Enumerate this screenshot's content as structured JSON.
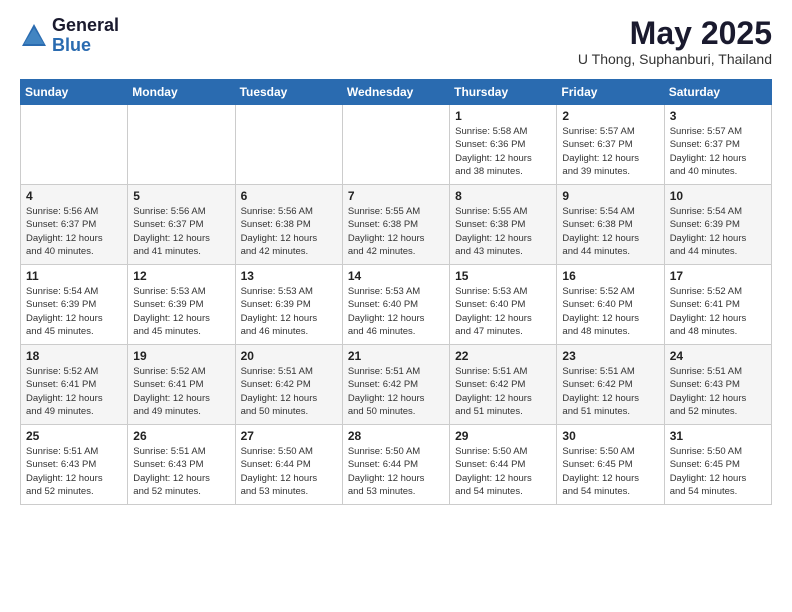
{
  "logo": {
    "general": "General",
    "blue": "Blue"
  },
  "title": "May 2025",
  "location": "U Thong, Suphanburi, Thailand",
  "weekdays": [
    "Sunday",
    "Monday",
    "Tuesday",
    "Wednesday",
    "Thursday",
    "Friday",
    "Saturday"
  ],
  "weeks": [
    [
      {
        "day": "",
        "info": ""
      },
      {
        "day": "",
        "info": ""
      },
      {
        "day": "",
        "info": ""
      },
      {
        "day": "",
        "info": ""
      },
      {
        "day": "1",
        "info": "Sunrise: 5:58 AM\nSunset: 6:36 PM\nDaylight: 12 hours\nand 38 minutes."
      },
      {
        "day": "2",
        "info": "Sunrise: 5:57 AM\nSunset: 6:37 PM\nDaylight: 12 hours\nand 39 minutes."
      },
      {
        "day": "3",
        "info": "Sunrise: 5:57 AM\nSunset: 6:37 PM\nDaylight: 12 hours\nand 40 minutes."
      }
    ],
    [
      {
        "day": "4",
        "info": "Sunrise: 5:56 AM\nSunset: 6:37 PM\nDaylight: 12 hours\nand 40 minutes."
      },
      {
        "day": "5",
        "info": "Sunrise: 5:56 AM\nSunset: 6:37 PM\nDaylight: 12 hours\nand 41 minutes."
      },
      {
        "day": "6",
        "info": "Sunrise: 5:56 AM\nSunset: 6:38 PM\nDaylight: 12 hours\nand 42 minutes."
      },
      {
        "day": "7",
        "info": "Sunrise: 5:55 AM\nSunset: 6:38 PM\nDaylight: 12 hours\nand 42 minutes."
      },
      {
        "day": "8",
        "info": "Sunrise: 5:55 AM\nSunset: 6:38 PM\nDaylight: 12 hours\nand 43 minutes."
      },
      {
        "day": "9",
        "info": "Sunrise: 5:54 AM\nSunset: 6:38 PM\nDaylight: 12 hours\nand 44 minutes."
      },
      {
        "day": "10",
        "info": "Sunrise: 5:54 AM\nSunset: 6:39 PM\nDaylight: 12 hours\nand 44 minutes."
      }
    ],
    [
      {
        "day": "11",
        "info": "Sunrise: 5:54 AM\nSunset: 6:39 PM\nDaylight: 12 hours\nand 45 minutes."
      },
      {
        "day": "12",
        "info": "Sunrise: 5:53 AM\nSunset: 6:39 PM\nDaylight: 12 hours\nand 45 minutes."
      },
      {
        "day": "13",
        "info": "Sunrise: 5:53 AM\nSunset: 6:39 PM\nDaylight: 12 hours\nand 46 minutes."
      },
      {
        "day": "14",
        "info": "Sunrise: 5:53 AM\nSunset: 6:40 PM\nDaylight: 12 hours\nand 46 minutes."
      },
      {
        "day": "15",
        "info": "Sunrise: 5:53 AM\nSunset: 6:40 PM\nDaylight: 12 hours\nand 47 minutes."
      },
      {
        "day": "16",
        "info": "Sunrise: 5:52 AM\nSunset: 6:40 PM\nDaylight: 12 hours\nand 48 minutes."
      },
      {
        "day": "17",
        "info": "Sunrise: 5:52 AM\nSunset: 6:41 PM\nDaylight: 12 hours\nand 48 minutes."
      }
    ],
    [
      {
        "day": "18",
        "info": "Sunrise: 5:52 AM\nSunset: 6:41 PM\nDaylight: 12 hours\nand 49 minutes."
      },
      {
        "day": "19",
        "info": "Sunrise: 5:52 AM\nSunset: 6:41 PM\nDaylight: 12 hours\nand 49 minutes."
      },
      {
        "day": "20",
        "info": "Sunrise: 5:51 AM\nSunset: 6:42 PM\nDaylight: 12 hours\nand 50 minutes."
      },
      {
        "day": "21",
        "info": "Sunrise: 5:51 AM\nSunset: 6:42 PM\nDaylight: 12 hours\nand 50 minutes."
      },
      {
        "day": "22",
        "info": "Sunrise: 5:51 AM\nSunset: 6:42 PM\nDaylight: 12 hours\nand 51 minutes."
      },
      {
        "day": "23",
        "info": "Sunrise: 5:51 AM\nSunset: 6:42 PM\nDaylight: 12 hours\nand 51 minutes."
      },
      {
        "day": "24",
        "info": "Sunrise: 5:51 AM\nSunset: 6:43 PM\nDaylight: 12 hours\nand 52 minutes."
      }
    ],
    [
      {
        "day": "25",
        "info": "Sunrise: 5:51 AM\nSunset: 6:43 PM\nDaylight: 12 hours\nand 52 minutes."
      },
      {
        "day": "26",
        "info": "Sunrise: 5:51 AM\nSunset: 6:43 PM\nDaylight: 12 hours\nand 52 minutes."
      },
      {
        "day": "27",
        "info": "Sunrise: 5:50 AM\nSunset: 6:44 PM\nDaylight: 12 hours\nand 53 minutes."
      },
      {
        "day": "28",
        "info": "Sunrise: 5:50 AM\nSunset: 6:44 PM\nDaylight: 12 hours\nand 53 minutes."
      },
      {
        "day": "29",
        "info": "Sunrise: 5:50 AM\nSunset: 6:44 PM\nDaylight: 12 hours\nand 54 minutes."
      },
      {
        "day": "30",
        "info": "Sunrise: 5:50 AM\nSunset: 6:45 PM\nDaylight: 12 hours\nand 54 minutes."
      },
      {
        "day": "31",
        "info": "Sunrise: 5:50 AM\nSunset: 6:45 PM\nDaylight: 12 hours\nand 54 minutes."
      }
    ]
  ]
}
